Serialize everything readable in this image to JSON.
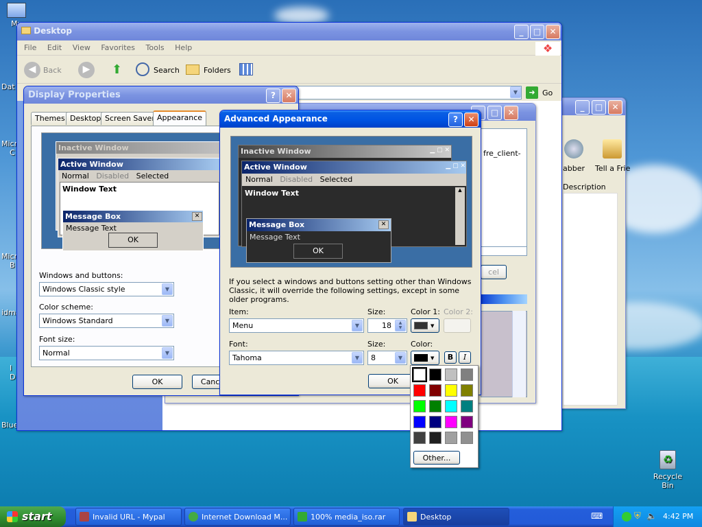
{
  "desktop": {
    "icons": [
      {
        "label": "My"
      },
      {
        "label": "Dat"
      },
      {
        "label": "Micro"
      },
      {
        "label": "C"
      },
      {
        "label": "Micro"
      },
      {
        "label": "B"
      },
      {
        "label": "idma"
      },
      {
        "label": "I"
      },
      {
        "label": "D"
      },
      {
        "label": "Blue"
      },
      {
        "label": "Recycle Bin"
      }
    ]
  },
  "explorer": {
    "title": "Desktop",
    "menu": [
      "File",
      "Edit",
      "View",
      "Favorites",
      "Tools",
      "Help"
    ],
    "toolbar": {
      "back": "Back",
      "search": "Search",
      "folders": "Folders"
    },
    "go": "Go"
  },
  "middle_window": {
    "text": "fre_client-",
    "cancel_fragment": "cel"
  },
  "right_window": {
    "labels": [
      "abber",
      "Tell a Frie"
    ],
    "column": "Description"
  },
  "display_props": {
    "title": "Display Properties",
    "tabs": [
      "Themes",
      "Desktop",
      "Screen Saver",
      "Appearance"
    ],
    "preview": {
      "inactive": "Inactive Window",
      "active": "Active Window",
      "menu": [
        "Normal",
        "Disabled",
        "Selected"
      ],
      "window_text": "Window Text",
      "msgbox_title": "Message Box",
      "msgbox_text": "Message Text",
      "ok": "OK"
    },
    "windows_buttons_label": "Windows and buttons:",
    "windows_buttons_value": "Windows Classic style",
    "color_scheme_label": "Color scheme:",
    "color_scheme_value": "Windows Standard",
    "font_size_label": "Font size:",
    "font_size_value": "Normal",
    "ok": "OK",
    "cancel": "Cance"
  },
  "advanced": {
    "title": "Advanced Appearance",
    "preview": {
      "inactive": "Inactive Window",
      "active": "Active Window",
      "menu": [
        "Normal",
        "Disabled",
        "Selected"
      ],
      "window_text": "Window Text",
      "msgbox_title": "Message Box",
      "msgbox_text": "Message Text",
      "ok": "OK"
    },
    "info": "If you select a windows and buttons setting other than Windows Classic, it will override the following settings, except in some older programs.",
    "item_label": "Item:",
    "item_value": "Menu",
    "size_label": "Size:",
    "size_value": "18",
    "color1_label": "Color 1:",
    "color2_label": "Color 2:",
    "font_label": "Font:",
    "font_value": "Tahoma",
    "font_size_label": "Size:",
    "font_size_value": "8",
    "color_label": "Color:",
    "bold": "B",
    "italic": "I",
    "ok": "OK"
  },
  "palette": {
    "colors": [
      "#ffffff",
      "#000000",
      "#c0c0c0",
      "#808080",
      "#ff0000",
      "#800000",
      "#ffff00",
      "#808000",
      "#00ff00",
      "#008000",
      "#00ffff",
      "#008080",
      "#0000ff",
      "#000080",
      "#ff00ff",
      "#800080",
      "#404040",
      "#202020",
      "#a0a0a0",
      "#909090"
    ],
    "other": "Other..."
  },
  "taskbar": {
    "start": "start",
    "tasks": [
      "Invalid URL - Mypal",
      "Internet Download M...",
      "100% media_iso.rar",
      "Desktop"
    ],
    "clock": "4:42 PM"
  }
}
